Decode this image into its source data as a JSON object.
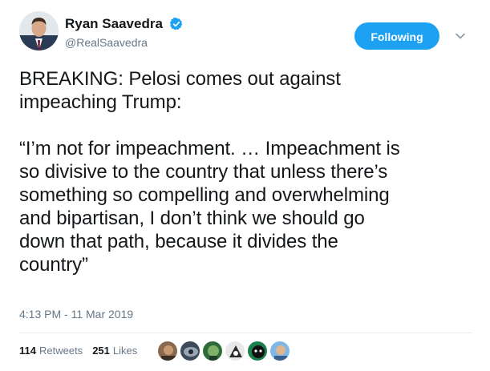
{
  "author": {
    "display_name": "Ryan Saavedra",
    "handle": "@RealSaavedra",
    "verified": true,
    "verified_icon": "verified-badge-icon"
  },
  "follow_button_label": "Following",
  "tweet_text": "BREAKING: Pelosi comes out against\nimpeaching Trump:\n\n“I’m not for impeachment. … Impeachment is\nso divisive to the country that unless there’s\nsomething so compelling and overwhelming\nand bipartisan, I don’t think we should go\ndown that path, because it divides the\ncountry”",
  "timestamp": "4:13 PM - 11 Mar 2019",
  "stats": {
    "retweets_count": "114",
    "retweets_label": "Retweets",
    "likes_count": "251",
    "likes_label": "Likes"
  },
  "colors": {
    "accent": "#1da1f2",
    "secondary_text": "#657786",
    "divider": "#e6ecf0"
  },
  "liker_avatars": [
    {
      "name": "liker-avatar-1"
    },
    {
      "name": "liker-avatar-2"
    },
    {
      "name": "liker-avatar-3"
    },
    {
      "name": "liker-avatar-4"
    },
    {
      "name": "liker-avatar-5"
    },
    {
      "name": "liker-avatar-6"
    }
  ]
}
